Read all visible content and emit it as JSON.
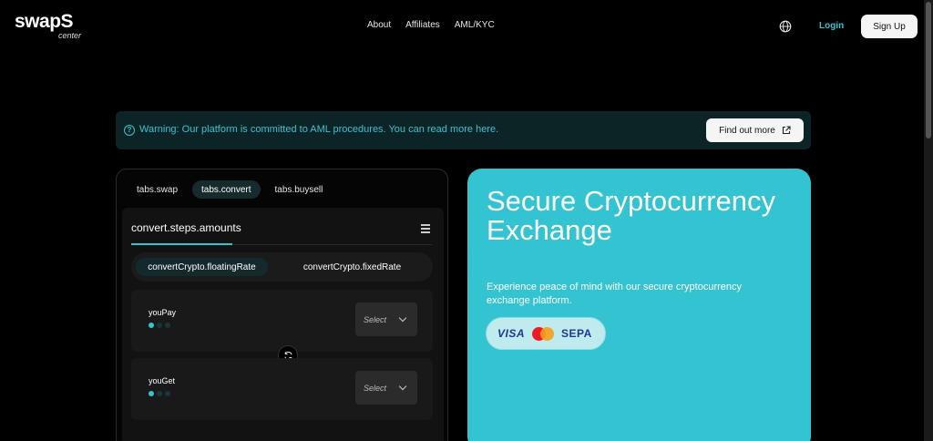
{
  "header": {
    "logo_main": "swapS",
    "logo_sub": "center",
    "nav": [
      "About",
      "Affiliates",
      "AML/KYC"
    ],
    "language_icon": "globe-icon",
    "login_label": "Login",
    "signup_label": "Sign Up"
  },
  "warning": {
    "icon": "help-circle-icon",
    "text": "Warning: Our platform is committed to AML procedures. You can read more here.",
    "button_label": "Find out more",
    "button_icon": "external-link-icon"
  },
  "converter": {
    "tabs": [
      {
        "label": "tabs.swap",
        "active": false
      },
      {
        "label": "tabs.convert",
        "active": true
      },
      {
        "label": "tabs.buysell",
        "active": false
      }
    ],
    "step_title": "convert.steps.amounts",
    "rates": {
      "floating": "convertCrypto.floatingRate",
      "fixed": "convertCrypto.fixedRate",
      "selected": "floating"
    },
    "you_pay": {
      "label": "youPay",
      "select_placeholder": "Select"
    },
    "you_get": {
      "label": "youGet",
      "select_placeholder": "Select"
    }
  },
  "hero": {
    "title": "Secure Cryptocurrency Exchange",
    "subtitle": "Experience peace of mind with our secure cryptocurrency exchange platform.",
    "payment_methods": [
      "VISA",
      "SEPA"
    ],
    "accent_color": "#34c3d0"
  },
  "colors": {
    "background": "#000000",
    "accent": "#36c2d0",
    "panel": "#121212"
  }
}
